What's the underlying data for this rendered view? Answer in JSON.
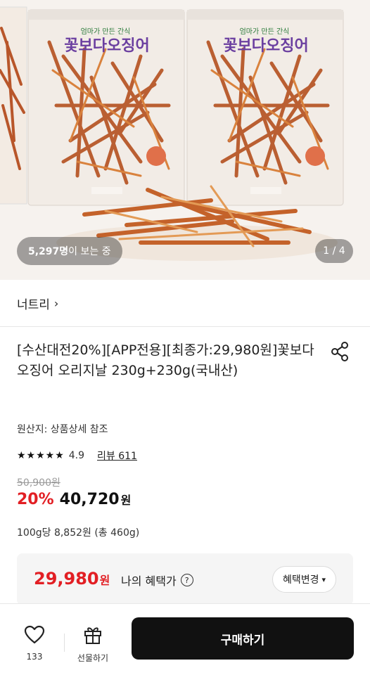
{
  "hero": {
    "viewer_count": "5,297명",
    "viewer_suffix": "이 보는 중",
    "page_indicator": "1 / 4",
    "package_brand": "꽃보다오징어",
    "package_slogan": "엄마가 만든 간식"
  },
  "seller": {
    "name": "너트리"
  },
  "product": {
    "title": "[수산대전20%][APP전용][최종가:29,980원]꽃보다오징어 오리지날 230g+230g(국내산)",
    "origin": "원산지: 상품상세 참조",
    "rating": "4.9",
    "stars": "★★★★★",
    "review": "리뷰 611",
    "original_price": "50,900원",
    "discount_rate": "20%",
    "sale_price": "40,720",
    "won": "원",
    "unit_price": "100g당 8,852원 (총 460g)"
  },
  "benefit": {
    "price": "29,980",
    "won": "원",
    "label": "나의 혜택가",
    "help": "?",
    "change_button": "혜택변경"
  },
  "bottom_bar": {
    "like_count": "133",
    "gift_label": "선물하기",
    "buy_label": "구매하기"
  },
  "colors": {
    "discount": "#e21f24",
    "buy_button": "#111111"
  }
}
